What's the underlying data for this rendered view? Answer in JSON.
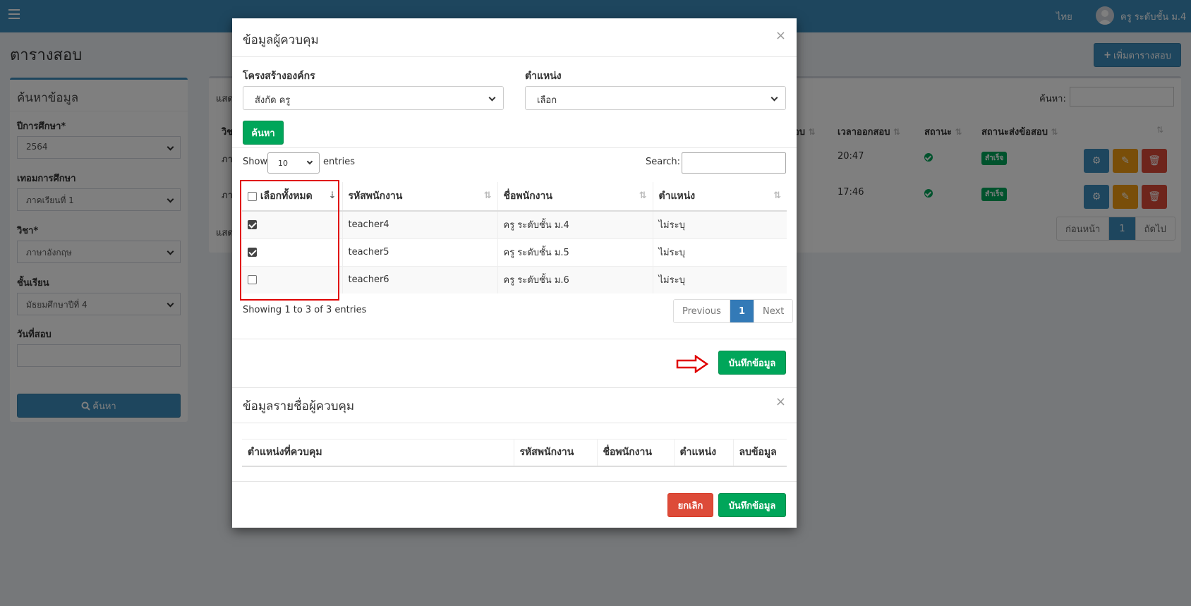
{
  "header": {
    "language": "ไทย",
    "username": "ครู ระดับชั้น ม.4"
  },
  "page": {
    "title": "ตารางสอบ",
    "add_button": "เพิ่มตารางสอบ"
  },
  "search_panel": {
    "title": "ค้นหาข้อมูล",
    "year_label": "ปีการศึกษา*",
    "year_value": "2564",
    "term_label": "เทอมการศึกษา",
    "term_value": "ภาคเรียนที่ 1",
    "subject_label": "วิชา*",
    "subject_value": "ภาษาอังกฤษ",
    "class_label": "ชั้นเรียน",
    "class_value": "มัธยมศึกษาปีที่ 4",
    "date_label": "วันที่สอบ",
    "date_value": "",
    "search_button": "ค้นหา"
  },
  "bg_table": {
    "show_prefix": "แสด",
    "search_label": "ค้นหา:",
    "header_partial": "วิช",
    "headers": [
      "อบ",
      "เวลาออกสอบ",
      "สถานะ",
      "สถานะส่งข้อสอบ"
    ],
    "rows": [
      {
        "prefix": "ภา",
        "time": "20:47",
        "status_badge": "สำเร็จ"
      },
      {
        "prefix": "ภา",
        "time": "17:46",
        "status_badge": "สำเร็จ"
      }
    ],
    "footer_prefix": "แสด",
    "pager": {
      "prev": "ก่อนหน้า",
      "page": "1",
      "next": "ถัดไป"
    }
  },
  "modal": {
    "title": "ข้อมูลผู้ควบคุม",
    "close": "×",
    "org_label": "โครงสร้างองค์กร",
    "org_value": "สังกัด ครู",
    "position_label": "ตำแหน่ง",
    "position_value": "เลือก",
    "search_button": "ค้นหา",
    "show_label": "Show",
    "entries_value": "10",
    "entries_label": "entries",
    "search_label": "Search:",
    "search_value": "",
    "columns": [
      "เลือกทั้งหมด",
      "รหัสพนักงาน",
      "ชื่อพนักงาน",
      "ตำแหน่ง"
    ],
    "rows": [
      {
        "checked": true,
        "code": "teacher4",
        "name": "ครู ระดับชั้น ม.4",
        "position": "ไม่ระบุ"
      },
      {
        "checked": true,
        "code": "teacher5",
        "name": "ครู ระดับชั้น ม.5",
        "position": "ไม่ระบุ"
      },
      {
        "checked": false,
        "code": "teacher6",
        "name": "ครู ระดับชั้น ม.6",
        "position": "ไม่ระบุ"
      }
    ],
    "info": "Showing 1 to 3 of 3 entries",
    "pager": {
      "prev": "Previous",
      "page": "1",
      "next": "Next"
    },
    "save_button": "บันทึกข้อมูล",
    "list_title": "ข้อมูลรายชื่อผู้ควบคุม",
    "list_close": "×",
    "list_columns": [
      "ตำแหน่งที่ควบคุม",
      "รหัสพนักงาน",
      "ชื่อพนักงาน",
      "ตำแหน่ง",
      "ลบข้อมูล"
    ],
    "cancel_button": "ยกเลิก",
    "footer_save_button": "บันทึกข้อมูล"
  },
  "colors": {
    "primary": "#3c8dbc",
    "success": "#00a65a",
    "warning": "#f39c12",
    "danger": "#dd4b39",
    "highlight": "#e00000"
  }
}
